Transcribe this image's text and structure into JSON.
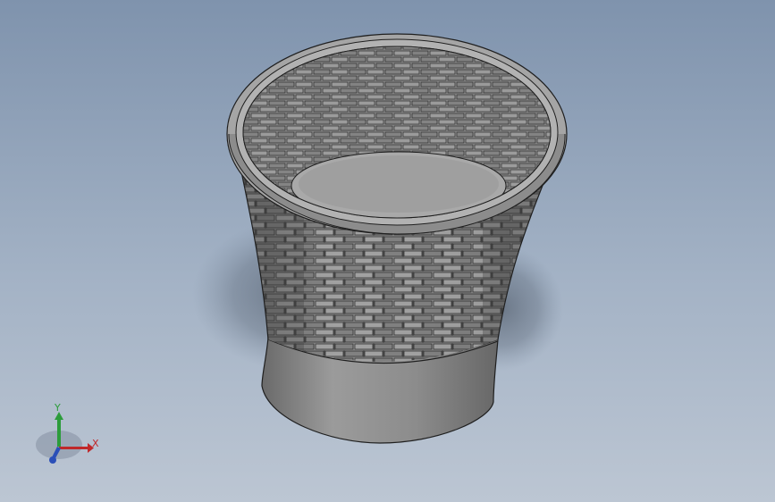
{
  "viewport": {
    "background_top": "#7f93ad",
    "background_bottom": "#bcc6d3"
  },
  "model": {
    "icon": "wicker-basket-3d-model",
    "body_color": "#8a8a8a",
    "rim_color": "#a5a5a5",
    "base_color": "#8d8d8d",
    "edge_color": "#1f1f1f"
  },
  "triad": {
    "icon": "coordinate-axes-triad",
    "x_label": "X",
    "y_label": "Y",
    "x_color": "#c0282a",
    "y_color": "#2c9c3b",
    "z_color": "#2b4fb8"
  }
}
